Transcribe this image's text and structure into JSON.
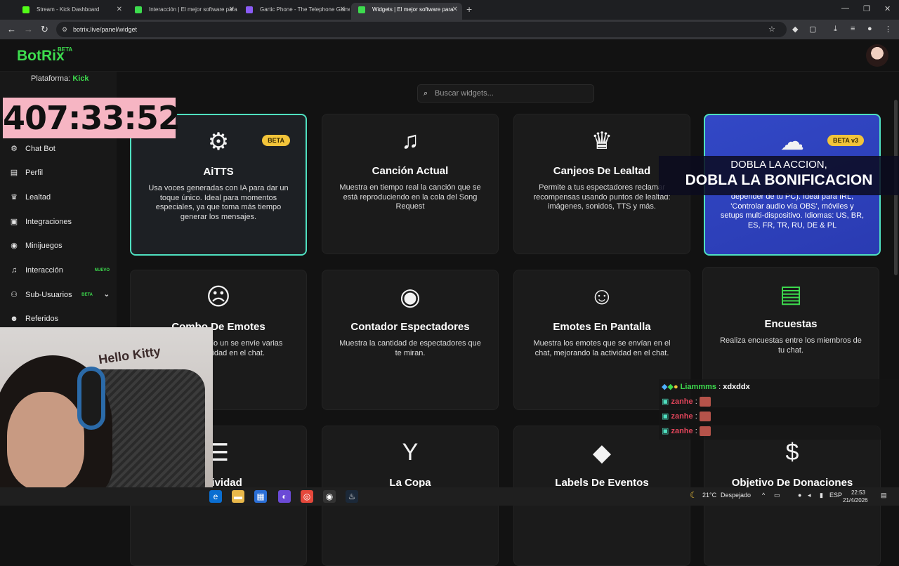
{
  "browser": {
    "tabs": [
      {
        "title": "Stream - Kick Dashboard",
        "color": "#53fc18"
      },
      {
        "title": "Interacción | El mejor software para",
        "color": "#3ddc4e"
      },
      {
        "title": "Gartic Phone - The Telephone Game",
        "color": "#8b5cf6"
      },
      {
        "title": "Widgets | El mejor software para",
        "color": "#3ddc4e"
      }
    ],
    "new_tab": "+",
    "url": "botrix.live/panel/widget"
  },
  "app": {
    "logo": "BotRix",
    "logo_badge": "BETA",
    "platform_label": "Plataforma:",
    "platform_value": "Kick"
  },
  "sidebar": {
    "items": [
      {
        "label": "Chat Bot",
        "icon": "robot-icon",
        "glyph": "⚙"
      },
      {
        "label": "Perfil",
        "icon": "id-card-icon",
        "glyph": "▤"
      },
      {
        "label": "Lealtad",
        "icon": "trophy-icon",
        "glyph": "♛"
      },
      {
        "label": "Integraciones",
        "icon": "integrations-icon",
        "glyph": "▣"
      },
      {
        "label": "Minijuegos",
        "icon": "gamepad-icon",
        "glyph": "◉"
      },
      {
        "label": "Interacción",
        "icon": "music-icon",
        "glyph": "♫",
        "badge": "NUEVO",
        "badge_color": "#3ddc4e"
      },
      {
        "label": "Sub-Usuarios",
        "icon": "users-icon",
        "glyph": "⚇",
        "badge": "BETA",
        "badge_color": "#3ddc4e"
      },
      {
        "label": "Referidos",
        "icon": "user-group-icon",
        "glyph": "☻"
      }
    ]
  },
  "overlay": {
    "timer": "407:33:52",
    "banner_line1": "DOBLA LA ACCION,",
    "banner_line2": "DOBLA LA BONIFICACION",
    "webcam_text": "Hello Kitty"
  },
  "search": {
    "placeholder": "Buscar widgets..."
  },
  "cards": [
    {
      "title": "AiTTS",
      "desc": "Usa voces generadas con IA para dar un toque único. Ideal para momentos especiales, ya que toma más tiempo generar los mensajes.",
      "badge": "BETA",
      "icon": "robot-icon",
      "glyph": "🤖"
    },
    {
      "title": "Canción Actual",
      "desc": "Muestra en tiempo real la canción que se está reproduciendo en la cola del Song Request",
      "icon": "music-note-icon",
      "glyph": "♫"
    },
    {
      "title": "Canjeos De Lealtad",
      "desc": "Permite a tus espectadores reclamar recompensas usando puntos de lealtad: imágenes, sonidos, TTS y más.",
      "icon": "trophy-icon",
      "glyph": "🏆"
    },
    {
      "title": "",
      "desc": "depender de tu PC). Ideal para IRL, 'Controlar audio vía OBS', móviles y setups multi-dispositivo. Idiomas: US, BR, ES, FR, TR, RU, DE & PL",
      "badge": "BETA v3",
      "icon": "cloud-icon",
      "glyph": "☁"
    },
    {
      "title": "Combo De Emotes",
      "desc": "de emotes cuando un se envíe varias veces, actividad en el chat.",
      "icon": "face-icon",
      "glyph": "☹"
    },
    {
      "title": "Contador Espectadores",
      "desc": "Muestra la cantidad de espectadores que te miran.",
      "icon": "eye-icon",
      "glyph": "👁"
    },
    {
      "title": "Emotes En Pantalla",
      "desc": "Muestra los emotes que se envían en el chat, mejorando la actividad en el chat.",
      "icon": "tongue-face-icon",
      "glyph": "😜"
    },
    {
      "title": "Encuestas",
      "desc": "Realiza encuestas entre los miembros de tu chat.",
      "icon": "poll-icon",
      "glyph": "▤"
    },
    {
      "title": "Actividad",
      "desc": "",
      "icon": "list-icon",
      "glyph": "☰"
    },
    {
      "title": "La Copa",
      "desc": "",
      "icon": "cocktail-icon",
      "glyph": "🍸"
    },
    {
      "title": "Labels De Eventos",
      "desc": "",
      "icon": "tags-icon",
      "glyph": "🏷"
    },
    {
      "title": "Objetivo De Donaciones",
      "desc": "",
      "icon": "dollar-icon",
      "glyph": "$"
    }
  ],
  "chat": [
    {
      "user": "Liammms",
      "sep": ":",
      "msg": "xdxddx",
      "color": "#3ddc4e",
      "emote": false
    },
    {
      "user": "zanhe",
      "sep": ":",
      "msg": "",
      "color": "#e0455a",
      "emote": true
    },
    {
      "user": "zanhe",
      "sep": ":",
      "msg": "",
      "color": "#e0455a",
      "emote": true
    },
    {
      "user": "zanhe",
      "sep": ":",
      "msg": "",
      "color": "#e0455a",
      "emote": true
    }
  ],
  "taskbar": {
    "weather": "21°C",
    "weather_desc": "Despejado",
    "lang": "ESP",
    "time": "22:53",
    "date": "21/4/2026"
  },
  "colors": {
    "accent": "#3ddc4e",
    "selected_border": "#4fe0c0",
    "badge_yellow": "#f2c43a",
    "timer_bg": "#f6b5c3"
  }
}
